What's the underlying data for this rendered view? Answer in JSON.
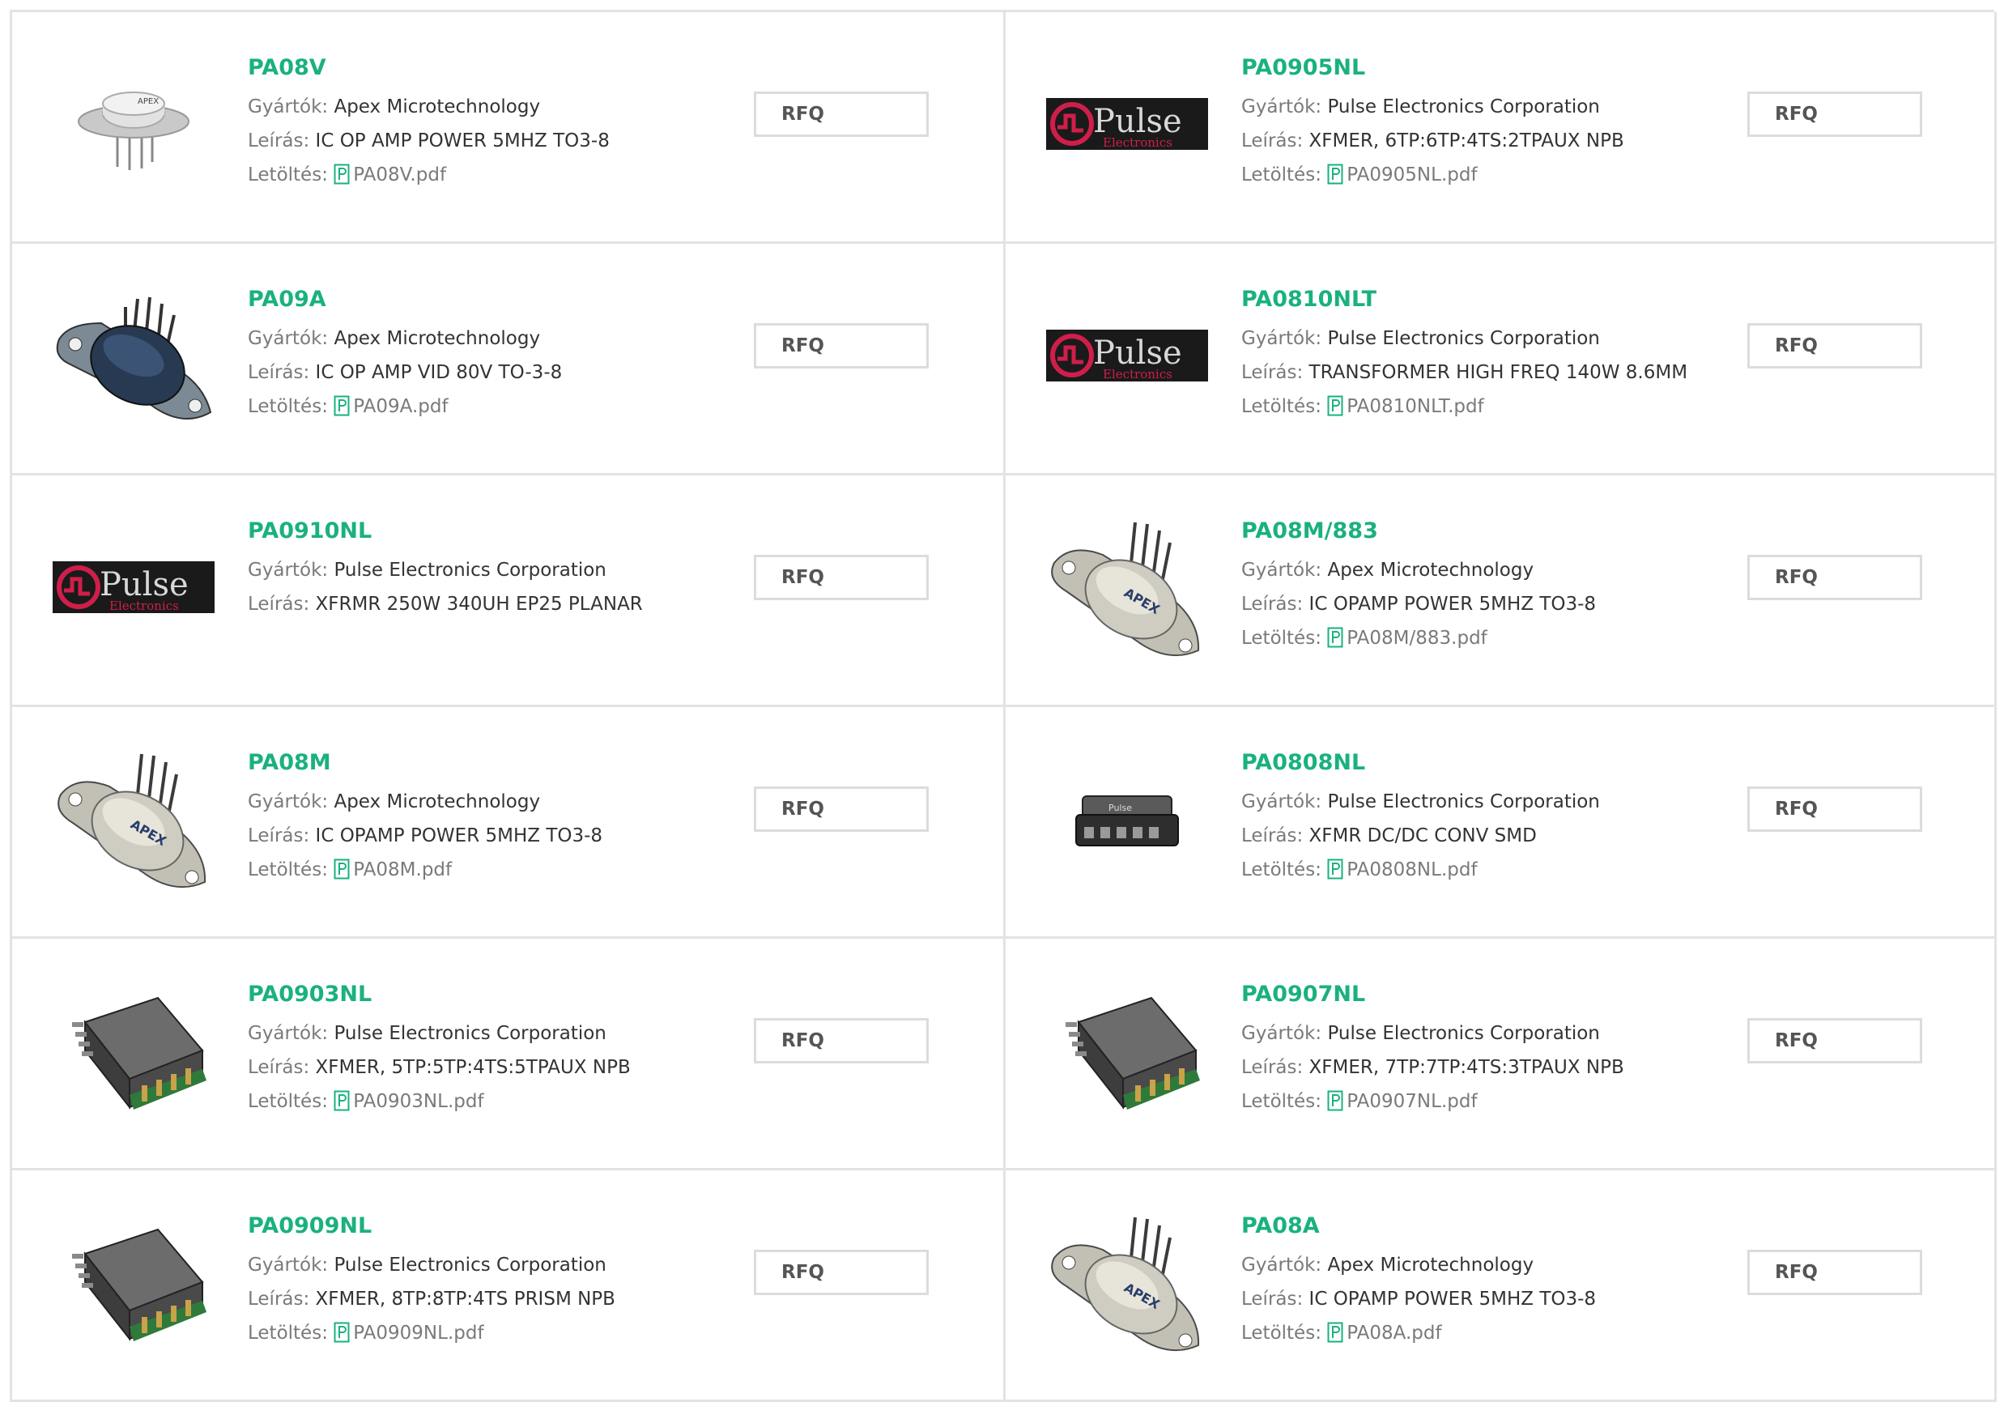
{
  "labels": {
    "manufacturer": "Gyártók:",
    "description": "Leírás:",
    "download": "Letöltés:"
  },
  "colors": {
    "part_link": "#1ab17f",
    "pulse_logo_bg": "#1a1a1a",
    "pulse_logo_red": "#d01e4a"
  },
  "logo": {
    "brand": "Pulse",
    "sub": "Electronics"
  },
  "products": [
    {
      "part": "PA08V",
      "manufacturer": "Apex Microtechnology",
      "description": "IC OP AMP POWER 5MHZ TO3-8",
      "pdf": "PA08V.pdf",
      "image": "to3-can-icon",
      "rfq": "RFQ"
    },
    {
      "part": "PA0905NL",
      "manufacturer": "Pulse Electronics Corporation",
      "description": "XFMER, 6TP:6TP:4TS:2TPAUX NPB",
      "pdf": "PA0905NL.pdf",
      "image": "pulse-logo",
      "rfq": "RFQ"
    },
    {
      "part": "PA09A",
      "manufacturer": "Apex Microtechnology",
      "description": "IC OP AMP VID 80V TO-3-8",
      "pdf": "PA09A.pdf",
      "image": "to3-dark-icon",
      "rfq": "RFQ"
    },
    {
      "part": "PA0810NLT",
      "manufacturer": "Pulse Electronics Corporation",
      "description": "TRANSFORMER HIGH FREQ 140W 8.6MM",
      "pdf": "PA0810NLT.pdf",
      "image": "pulse-logo",
      "rfq": "RFQ"
    },
    {
      "part": "PA0910NL",
      "manufacturer": "Pulse Electronics Corporation",
      "description": "XFRMR 250W 340UH EP25 PLANAR",
      "pdf": "",
      "image": "pulse-logo",
      "rfq": "RFQ"
    },
    {
      "part": "PA08M/883",
      "manufacturer": "Apex Microtechnology",
      "description": "IC OPAMP POWER 5MHZ TO3-8",
      "pdf": "PA08M/883.pdf",
      "image": "to3-silver-icon",
      "rfq": "RFQ"
    },
    {
      "part": "PA08M",
      "manufacturer": "Apex Microtechnology",
      "description": "IC OPAMP POWER 5MHZ TO3-8",
      "pdf": "PA08M.pdf",
      "image": "to3-silver-icon",
      "rfq": "RFQ"
    },
    {
      "part": "PA0808NL",
      "manufacturer": "Pulse Electronics Corporation",
      "description": "XFMR DC/DC CONV SMD",
      "pdf": "PA0808NL.pdf",
      "image": "smd-transformer-icon",
      "rfq": "RFQ"
    },
    {
      "part": "PA0903NL",
      "manufacturer": "Pulse Electronics Corporation",
      "description": "XFMER, 5TP:5TP:4TS:5TPAUX NPB",
      "pdf": "PA0903NL.pdf",
      "image": "planar-transformer-icon",
      "rfq": "RFQ"
    },
    {
      "part": "PA0907NL",
      "manufacturer": "Pulse Electronics Corporation",
      "description": "XFMER, 7TP:7TP:4TS:3TPAUX NPB",
      "pdf": "PA0907NL.pdf",
      "image": "planar-transformer-icon",
      "rfq": "RFQ"
    },
    {
      "part": "PA0909NL",
      "manufacturer": "Pulse Electronics Corporation",
      "description": "XFMER, 8TP:8TP:4TS PRISM NPB",
      "pdf": "PA0909NL.pdf",
      "image": "planar-transformer-icon",
      "rfq": "RFQ"
    },
    {
      "part": "PA08A",
      "manufacturer": "Apex Microtechnology",
      "description": "IC OPAMP POWER 5MHZ TO3-8",
      "pdf": "PA08A.pdf",
      "image": "to3-silver-icon",
      "rfq": "RFQ"
    }
  ]
}
